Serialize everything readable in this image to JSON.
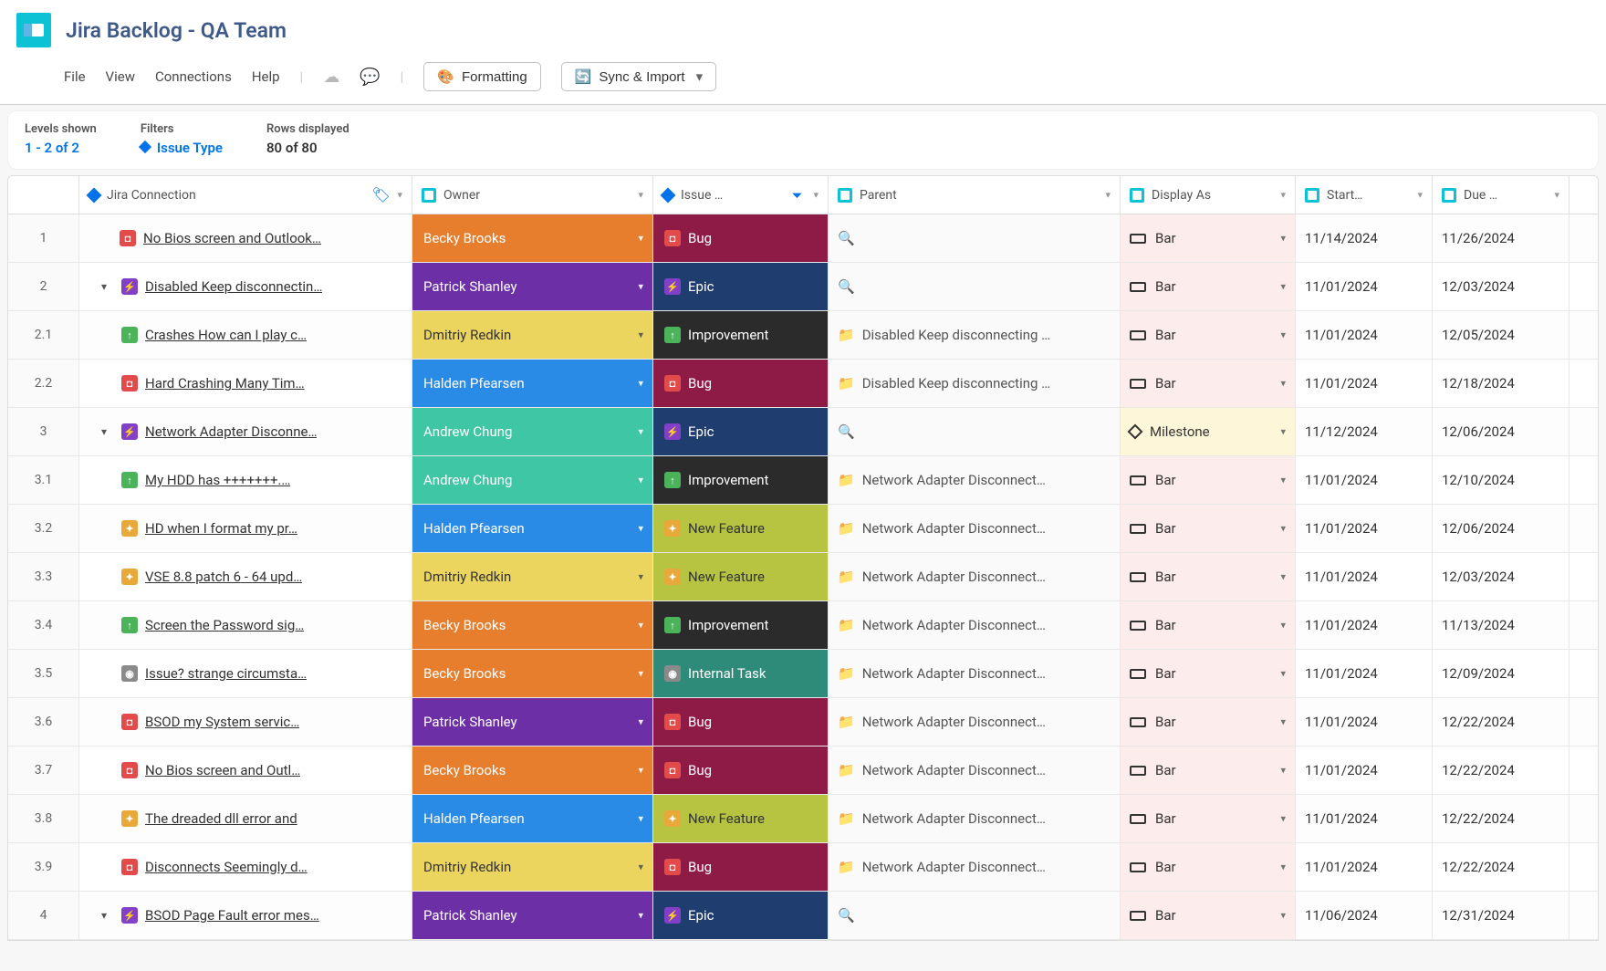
{
  "header": {
    "title": "Jira Backlog - QA Team",
    "menu": {
      "file": "File",
      "view": "View",
      "connections": "Connections",
      "help": "Help"
    },
    "buttons": {
      "formatting": "Formatting",
      "sync": "Sync & Import"
    }
  },
  "summary": {
    "levels_label": "Levels shown",
    "levels_value": "1 - 2 of 2",
    "filters_label": "Filters",
    "filters_value": "Issue Type",
    "rows_label": "Rows displayed",
    "rows_value": "80 of 80"
  },
  "columns": {
    "jira": "Jira Connection",
    "owner": "Owner",
    "issue": "Issue …",
    "parent": "Parent",
    "display": "Display As",
    "start": "Start…",
    "due": "Due …"
  },
  "owners": {
    "becky": "Becky Brooks",
    "patrick": "Patrick Shanley",
    "dmitriy": "Dmitriy Redkin",
    "halden": "Halden Pfearsen",
    "andrew": "Andrew Chung"
  },
  "issue_types": {
    "Bug": "Bug",
    "Epic": "Epic",
    "Improvement": "Improvement",
    "New Feature": "New Feature",
    "Internal Task": "Internal Task"
  },
  "display_as": {
    "Bar": "Bar",
    "Milestone": "Milestone"
  },
  "rows": [
    {
      "num": "1",
      "indent": 0,
      "expand": false,
      "type": "Bug",
      "title": "No Bios screen and Outlook…",
      "owner": "becky",
      "issue": "Bug",
      "parent": "",
      "display": "Bar",
      "start": "11/14/2024",
      "due": "11/26/2024"
    },
    {
      "num": "2",
      "indent": 0,
      "expand": true,
      "type": "Epic",
      "title": "Disabled Keep disconnectin…",
      "owner": "patrick",
      "issue": "Epic",
      "parent": "",
      "display": "Bar",
      "start": "11/01/2024",
      "due": "12/03/2024"
    },
    {
      "num": "2.1",
      "indent": 1,
      "expand": false,
      "type": "Improvement",
      "title": "Crashes How can I play c…",
      "owner": "dmitriy",
      "issue": "Improvement",
      "parent": "Disabled Keep disconnecting …",
      "display": "Bar",
      "start": "11/01/2024",
      "due": "12/05/2024"
    },
    {
      "num": "2.2",
      "indent": 1,
      "expand": false,
      "type": "Bug",
      "title": "Hard Crashing Many Tim…",
      "owner": "halden",
      "issue": "Bug",
      "parent": "Disabled Keep disconnecting …",
      "display": "Bar",
      "start": "11/01/2024",
      "due": "12/18/2024"
    },
    {
      "num": "3",
      "indent": 0,
      "expand": true,
      "type": "Epic",
      "title": "Network Adapter Disconne…",
      "owner": "andrew",
      "issue": "Epic",
      "parent": "",
      "display": "Milestone",
      "start": "11/12/2024",
      "due": "12/06/2024"
    },
    {
      "num": "3.1",
      "indent": 1,
      "expand": false,
      "type": "Improvement",
      "title": "My HDD has +++++++.…",
      "owner": "andrew",
      "issue": "Improvement",
      "parent": "Network Adapter Disconnect…",
      "display": "Bar",
      "start": "11/01/2024",
      "due": "12/10/2024"
    },
    {
      "num": "3.2",
      "indent": 1,
      "expand": false,
      "type": "New Feature",
      "title": "HD when I format my pr…",
      "owner": "halden",
      "issue": "New Feature",
      "parent": "Network Adapter Disconnect…",
      "display": "Bar",
      "start": "11/01/2024",
      "due": "12/06/2024"
    },
    {
      "num": "3.3",
      "indent": 1,
      "expand": false,
      "type": "New Feature",
      "title": "VSE 8.8 patch 6 - 64 upd…",
      "owner": "dmitriy",
      "issue": "New Feature",
      "parent": "Network Adapter Disconnect…",
      "display": "Bar",
      "start": "11/01/2024",
      "due": "12/03/2024"
    },
    {
      "num": "3.4",
      "indent": 1,
      "expand": false,
      "type": "Improvement",
      "title": "Screen the Password sig…",
      "owner": "becky",
      "issue": "Improvement",
      "parent": "Network Adapter Disconnect…",
      "display": "Bar",
      "start": "11/01/2024",
      "due": "11/13/2024"
    },
    {
      "num": "3.5",
      "indent": 1,
      "expand": false,
      "type": "Internal Task",
      "title": "Issue? strange circumsta…",
      "owner": "becky",
      "issue": "Internal Task",
      "parent": "Network Adapter Disconnect…",
      "display": "Bar",
      "start": "11/01/2024",
      "due": "12/09/2024"
    },
    {
      "num": "3.6",
      "indent": 1,
      "expand": false,
      "type": "Bug",
      "title": "BSOD my System servic…",
      "owner": "patrick",
      "issue": "Bug",
      "parent": "Network Adapter Disconnect…",
      "display": "Bar",
      "start": "11/01/2024",
      "due": "12/22/2024"
    },
    {
      "num": "3.7",
      "indent": 1,
      "expand": false,
      "type": "Bug",
      "title": "No Bios screen and Outl…",
      "owner": "becky",
      "issue": "Bug",
      "parent": "Network Adapter Disconnect…",
      "display": "Bar",
      "start": "11/01/2024",
      "due": "12/22/2024"
    },
    {
      "num": "3.8",
      "indent": 1,
      "expand": false,
      "type": "New Feature",
      "title": "The dreaded dll error and",
      "owner": "halden",
      "issue": "New Feature",
      "parent": "Network Adapter Disconnect…",
      "display": "Bar",
      "start": "11/01/2024",
      "due": "12/22/2024"
    },
    {
      "num": "3.9",
      "indent": 1,
      "expand": false,
      "type": "Bug",
      "title": "Disconnects Seemingly d…",
      "owner": "dmitriy",
      "issue": "Bug",
      "parent": "Network Adapter Disconnect…",
      "display": "Bar",
      "start": "11/01/2024",
      "due": "12/22/2024"
    },
    {
      "num": "4",
      "indent": 0,
      "expand": true,
      "type": "Epic",
      "title": "BSOD Page Fault error mes…",
      "owner": "patrick",
      "issue": "Epic",
      "parent": "",
      "display": "Bar",
      "start": "11/06/2024",
      "due": "12/31/2024"
    }
  ]
}
